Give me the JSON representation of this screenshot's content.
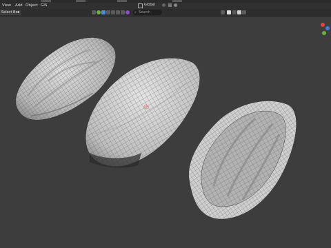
{
  "header": {
    "menus": [
      {
        "label": "View"
      },
      {
        "label": "Add"
      },
      {
        "label": "Object"
      },
      {
        "label": "GIS"
      }
    ]
  },
  "toolbar": {
    "select_mode": "Select Box",
    "transform_orientation": "Global",
    "search_placeholder": "Search"
  },
  "viewport": {
    "icons": [
      "snap-icon",
      "proportional-edit-icon",
      "overlay-icon",
      "shading-icon"
    ]
  },
  "colors": {
    "background": "#3d3d3d",
    "header": "#303030",
    "toolbar": "#2d2d2d",
    "mesh_fill": "#c9c9c9",
    "mesh_wire": "#4a4a4a",
    "gizmo_x": "#e0453f",
    "gizmo_y": "#6ab43a",
    "gizmo_z": "#3e7fe0"
  }
}
